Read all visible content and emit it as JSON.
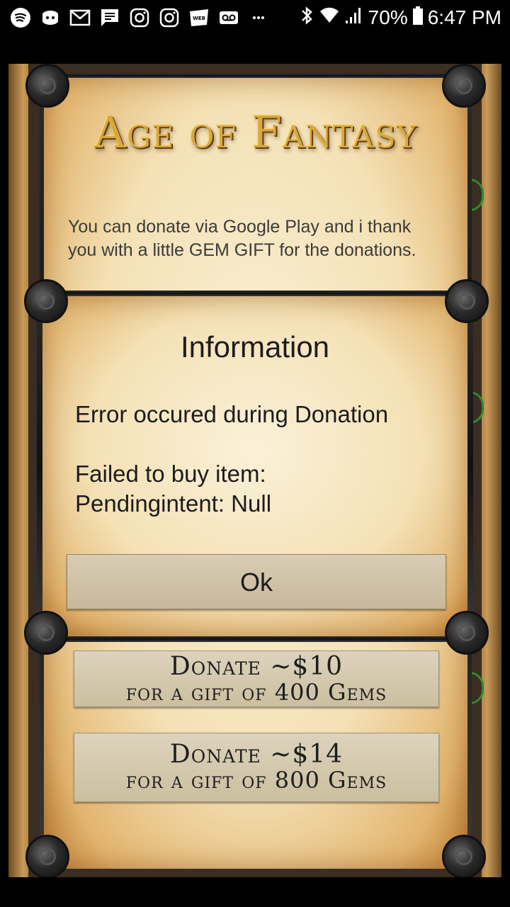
{
  "status_bar": {
    "battery": "70%",
    "time": "6:47 PM",
    "icons": [
      "spotify-icon",
      "discord-icon",
      "gmail-icon",
      "message-icon",
      "instagram-icon",
      "instagram-icon",
      "webtoon-icon",
      "voicemail-icon",
      "more-icon",
      "bluetooth-icon",
      "wifi-icon",
      "signal-icon",
      "battery-icon"
    ]
  },
  "game": {
    "logo": "Age of Fantasy",
    "intro": "You can donate via Google Play and i thank you with a little GEM GIFT for the donations.",
    "donate_buttons": [
      {
        "line1": "Donate ~$10",
        "line2": "for a gift of 400 Gems"
      },
      {
        "line1": "Donate ~$14",
        "line2": "for a gift of 800 Gems"
      }
    ]
  },
  "dialog": {
    "title": "Information",
    "message_line1": "Error occured during Donation",
    "message_line2": "Failed to buy item:",
    "message_line3": "Pendingintent: Null",
    "ok_label": "Ok"
  }
}
